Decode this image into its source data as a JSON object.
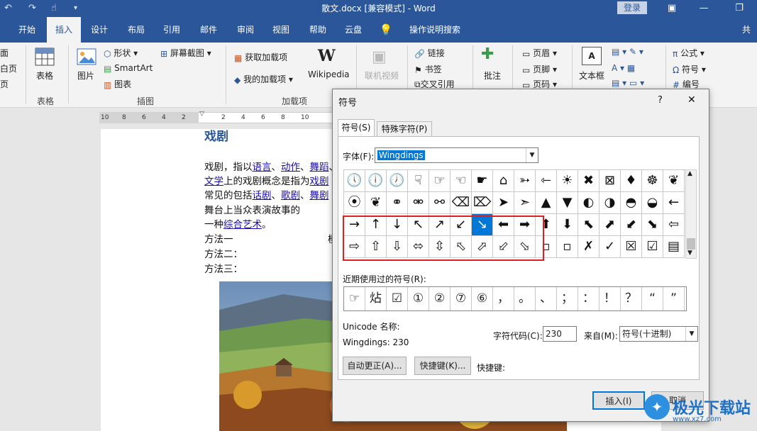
{
  "window": {
    "title": "散文.docx [兼容模式] - Word",
    "login": "登录",
    "minimize_glyph": "—",
    "restore_glyph": "❐",
    "close_glyph": "✕"
  },
  "tabs": [
    "开始",
    "插入",
    "设计",
    "布局",
    "引用",
    "邮件",
    "审阅",
    "视图",
    "帮助",
    "云盘",
    "操作说明搜索",
    "共"
  ],
  "ribbon": {
    "pages_group": [
      "面",
      "白页",
      "页"
    ],
    "table_label": "表格",
    "table_group": "表格",
    "picture_label": "图片",
    "shapes_label": "形状",
    "smartart_label": "SmartArt",
    "chart_label": "图表",
    "screenshot_label": "屏幕截图",
    "illustrations_group": "插图",
    "get_addins_label": "获取加载项",
    "my_addins_label": "我的加载项",
    "wikipedia_label": "Wikipedia",
    "addins_group": "加载项",
    "online_video_label": "联机视频",
    "link_label": "链接",
    "bookmark_label": "书签",
    "crossref_label": "交叉引用",
    "comment_label": "批注",
    "header_label": "页眉",
    "footer_label": "页脚",
    "pagenum_label": "页码",
    "textbox_label": "文本框",
    "formula_label": "公式",
    "symbol_label": "符号",
    "number_label": "编号"
  },
  "ruler": [
    "10",
    "8",
    "6",
    "4",
    "2",
    "2",
    "4",
    "6",
    "8",
    "10"
  ],
  "document": {
    "heading": "戏剧",
    "l1_pre": "戏剧，指以",
    "l1_link1": "语言",
    "l1_sep1": "、",
    "l1_link2": "动作",
    "l1_sep2": "、",
    "l1_link3": "舞蹈",
    "l1_sep3": "、",
    "l2_link1": "文学",
    "l2_mid": "上的戏剧概念是指为",
    "l2_link2": "戏剧",
    "l3_pre": "常见的包括",
    "l3_link1": "话剧",
    "l3_sep1": "、",
    "l3_link2": "歌剧",
    "l3_sep2": "、",
    "l3_link3": "舞剧",
    "l4": "舞台上当众表演故事的",
    "l5_pre": "一种",
    "l5_link": "综合艺术",
    "l5_post": "。",
    "method1": "方法一",
    "method1_tail": "模",
    "method2": "方法二：",
    "method3": "方法三："
  },
  "dialog": {
    "title": "符号",
    "help": "?",
    "close": "✕",
    "tab_symbols": "符号(S)",
    "tab_special": "特殊字符(P)",
    "font_label": "字体(F):",
    "font_value": "Wingdings",
    "grid": [
      [
        "🕔",
        "🕕",
        "🕖",
        "☟",
        "☞",
        "☜",
        "☛",
        "⌂",
        "➳",
        "⇽",
        "☀",
        "✖",
        "⊠",
        "♦",
        "☸",
        "❦"
      ],
      [
        "⦿",
        "❦",
        "⚭",
        "⚮",
        "⚯",
        "⌫",
        "⌦",
        "➤",
        "➣",
        "▲",
        "▼",
        "◐",
        "◑",
        "◓",
        "◒",
        "←"
      ],
      [
        "→",
        "↑",
        "↓",
        "↖",
        "↗",
        "↙",
        "↘",
        "⬅",
        "➡",
        "⬆",
        "⬇",
        "⬉",
        "⬈",
        "⬋",
        "⬊",
        "⇦"
      ],
      [
        "⇨",
        "⇧",
        "⇩",
        "⬄",
        "⇳",
        "⬁",
        "⬀",
        "⬃",
        "⬂",
        "▫",
        "▫",
        "✗",
        "✓",
        "☒",
        "☑",
        "▤"
      ]
    ],
    "selected": {
      "row": 2,
      "col": 6
    },
    "recent_label": "近期使用过的符号(R):",
    "recent": [
      "☞",
      "炶",
      "☑",
      "①",
      "②",
      "⑦",
      "⑥",
      "，",
      "。",
      "、",
      "；",
      "：",
      "！",
      "？",
      "“",
      "”"
    ],
    "unicode_name_label": "Unicode 名称:",
    "unicode_name_value": "Wingdings: 230",
    "charcode_label": "字符代码(C):",
    "charcode_value": "230",
    "from_label": "来自(M):",
    "from_value": "符号(十进制)",
    "autocorrect_btn": "自动更正(A)...",
    "shortcut_btn": "快捷键(K)...",
    "shortcut_label": "快捷键:",
    "insert_btn": "插入(I)",
    "cancel_btn": "取消"
  },
  "colors": {
    "titlebar": "#2b579a",
    "selection": "#0078d7",
    "highlight_box": "#e02020"
  },
  "watermark": "极光下载站"
}
